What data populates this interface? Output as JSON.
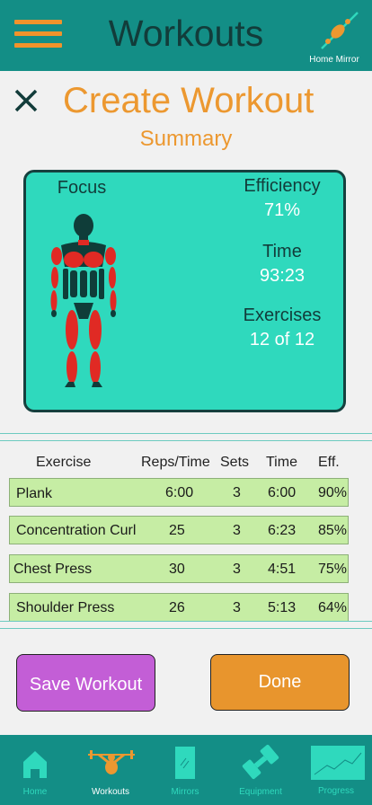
{
  "header": {
    "title": "Workouts",
    "mirror_label": "Home Mirror"
  },
  "page": {
    "title": "Create Workout",
    "subtitle": "Summary"
  },
  "summary_card": {
    "focus_label": "Focus",
    "efficiency_label": "Efficiency",
    "efficiency_value": "71%",
    "time_label": "Time",
    "time_value": "93:23",
    "exercises_label": "Exercises",
    "exercises_value": "12 of 12"
  },
  "table": {
    "headers": [
      "Exercise",
      "Reps/Time",
      "Sets",
      "Time",
      "Eff."
    ],
    "rows": [
      [
        "Plank",
        "6:00",
        "3",
        "6:00",
        "90%"
      ],
      [
        "Concentration Curl",
        "25",
        "3",
        "6:23",
        "85%"
      ],
      [
        "Chest Press",
        "30",
        "3",
        "4:51",
        "75%"
      ],
      [
        "Shoulder Press",
        "26",
        "3",
        "5:13",
        "64%"
      ]
    ]
  },
  "buttons": {
    "save": "Save Workout",
    "done": "Done"
  },
  "tabs": [
    {
      "label": "Home",
      "icon": "home-icon"
    },
    {
      "label": "Workouts",
      "icon": "workout-icon",
      "active": true
    },
    {
      "label": "Mirrors",
      "icon": "mirror-icon"
    },
    {
      "label": "Equipment",
      "icon": "dumbbell-icon"
    },
    {
      "label": "Progress",
      "icon": "progress-chart-icon"
    }
  ],
  "colors": {
    "header": "#138e86",
    "accent_orange": "#ec9830",
    "card": "#2fd9bd",
    "row": "#c6eda4",
    "save_button": "#c35ed6",
    "done_button": "#e8952d",
    "muscle_highlight": "#e02a24"
  }
}
